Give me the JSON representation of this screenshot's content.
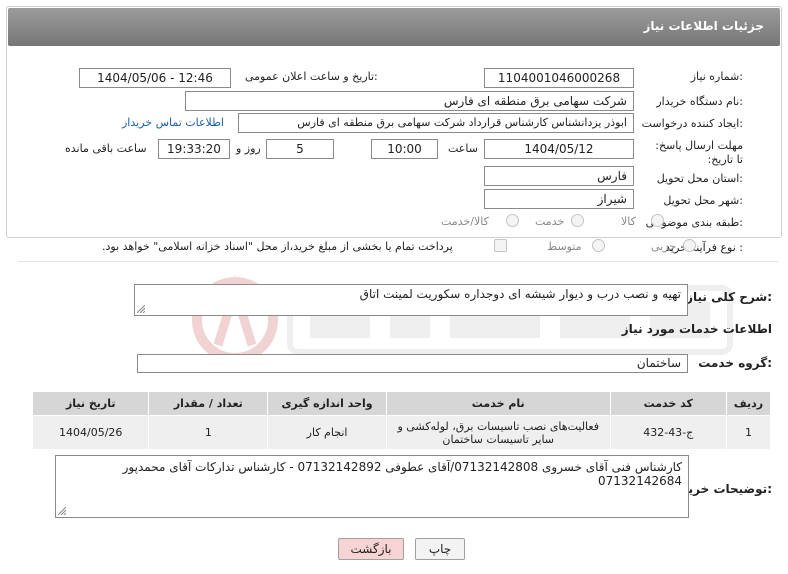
{
  "header": {
    "title": "جزئیات اطلاعات نیاز"
  },
  "form": {
    "need_number_label": "شماره نیاز:",
    "need_number": "1104001046000268",
    "announce_label": "تاریخ و ساعت اعلان عمومی:",
    "announce_value": "1404/05/06 - 12:46",
    "buyer_org_label": "نام دستگاه خریدار:",
    "buyer_org": "شرکت سهامی برق منطقه ای فارس",
    "creator_label": "ایجاد کننده درخواست:",
    "creator": "ابوذر  یزدانشناس کارشناس قرارداد شرکت سهامی برق منطقه ای فارس",
    "buyer_contact_link": "اطلاعات تماس خریدار",
    "deadline_label": "مهلت ارسال پاسخ: تا تاریخ:",
    "deadline_date": "1404/05/12",
    "time_label": "ساعت",
    "deadline_time": "10:00",
    "days_value": "5",
    "days_label": "روز و",
    "remaining_time": "19:33:20",
    "remaining_label": "ساعت باقی مانده",
    "province_label": "استان محل تحویل:",
    "province": "فارس",
    "city_label": "شهر محل تحویل:",
    "city": "شیراز",
    "category_label": "طبقه بندی موضوعی:",
    "category_options": [
      "کالا",
      "خدمت",
      "کالا/خدمت"
    ],
    "process_label": "نوع فرآیند خرید :",
    "process_options": [
      "جزیی",
      "متوسط"
    ],
    "payment_note": "پرداخت تمام یا بخشی از مبلغ خرید،از محل \"اسناد خزانه اسلامی\" خواهد بود."
  },
  "summary": {
    "label": "شرح کلی نیاز:",
    "text": "تهیه و نصب درب و دیوار شیشه ای دوجداره سکوریت لمینت اتاق"
  },
  "services": {
    "section_title": "اطلاعات خدمات مورد نیاز",
    "group_label": "گروه خدمت:",
    "group_value": "ساختمان",
    "columns": [
      "ردیف",
      "کد خدمت",
      "نام خدمت",
      "واحد اندازه گیری",
      "تعداد / مقدار",
      "تاریخ نیاز"
    ],
    "rows": [
      {
        "row": "1",
        "code": "ج-43-432",
        "name": "فعالیت‌های نصب تاسیسات برق، لوله‌کشی و سایر تاسیسات ساختمان",
        "unit": "انجام کار",
        "qty": "1",
        "date": "1404/05/26"
      }
    ]
  },
  "buyer_notes": {
    "label": "توضیحات خریدار:",
    "text": "کارشناس فنی آقای خسروی 07132142808/آقای عطوفی 07132142892 - کارشناس تدارکات آقای محمدپور 07132142684"
  },
  "buttons": {
    "print": "چاپ",
    "back": "بازگشت"
  },
  "colors": {
    "header_bg": "#8a8a8a",
    "link": "#1a5fb4",
    "back_button_bg": "#f6d4d4"
  }
}
